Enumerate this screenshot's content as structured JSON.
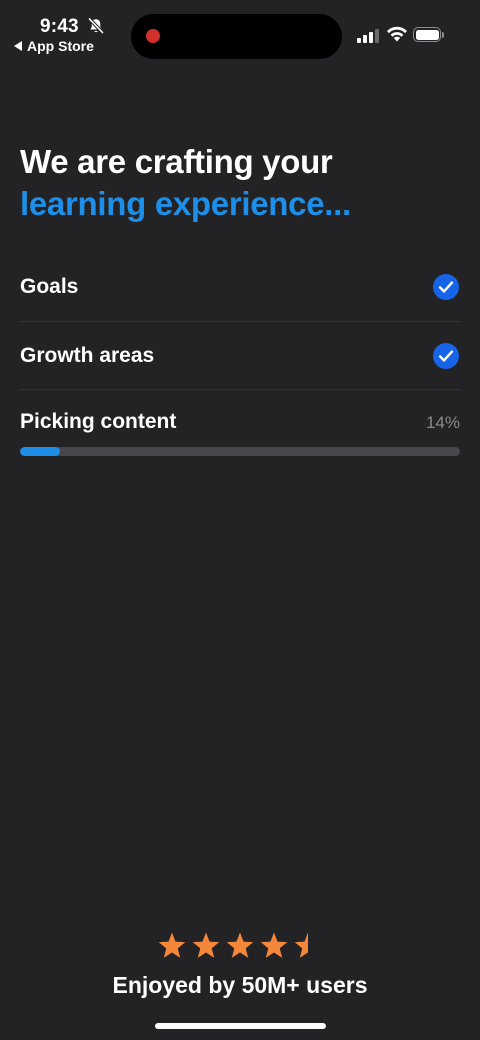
{
  "status_bar": {
    "time": "9:43",
    "back_label": "App Store",
    "muted_icon": "bell-slash-icon",
    "recording_indicator_color": "#d1302c",
    "signal_bars_active": 3,
    "signal_bars_total": 4,
    "battery_level": 1.0
  },
  "heading": {
    "line1": "We are crafting your",
    "line2": "learning experience..."
  },
  "steps": [
    {
      "label": "Goals",
      "status": "done",
      "icon": "checkmark-circle-icon"
    },
    {
      "label": "Growth areas",
      "status": "done",
      "icon": "checkmark-circle-icon"
    }
  ],
  "progress": {
    "label": "Picking content",
    "percent_text": "14%",
    "value": 0.09
  },
  "rating": {
    "stars": 4.5,
    "star_color": "#f5873a"
  },
  "tagline": "Enjoyed by 50M+ users",
  "colors": {
    "background": "#232225",
    "accent": "#1e8fe8",
    "check": "#1764e8",
    "text": "#ffffff",
    "muted_text": "#8b8a8f"
  }
}
